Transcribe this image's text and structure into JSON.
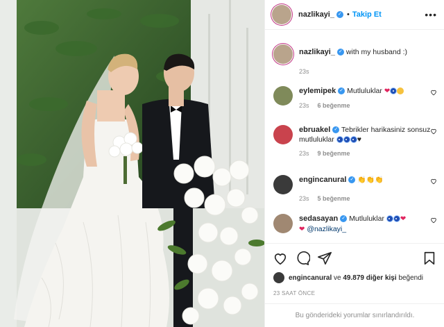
{
  "photo": {
    "alt": "wedding photo"
  },
  "header": {
    "username": "nazlikayi_",
    "follow_label": "Takip Et",
    "separator": "•",
    "more_label": "•••"
  },
  "caption": {
    "username": "nazlikayi_",
    "text": "with my husband :)",
    "time": "23s"
  },
  "comments": [
    {
      "username": "eylemipek",
      "text": "Mutluluklar",
      "time": "23s",
      "likes": "6 beğenme",
      "reply": ""
    },
    {
      "username": "ebruakel",
      "text": "Tebrikler harikasiniz sonsuz mutluluklar",
      "time": "23s",
      "likes": "9 beğenme"
    },
    {
      "username": "engincanural",
      "text": "",
      "time": "23s",
      "likes": "5 beğenme"
    },
    {
      "username": "sedasayan",
      "text": "Mutluluklar",
      "mention": "@nazlikayi_",
      "time": "",
      "likes": ""
    }
  ],
  "liked_by": {
    "username": "engincanural",
    "conj": "ve",
    "others": "49.879 diğer kişi",
    "verb": "beğendi"
  },
  "timestamp": "23 SAAT ÖNCE",
  "comments_limited": "Bu gönderideki yorumlar sınırlandırıldı.",
  "colors": {
    "accent": "#0095f6",
    "verified": "#3897f0",
    "heart": "#e0245e",
    "muted": "#8e8e8e"
  }
}
